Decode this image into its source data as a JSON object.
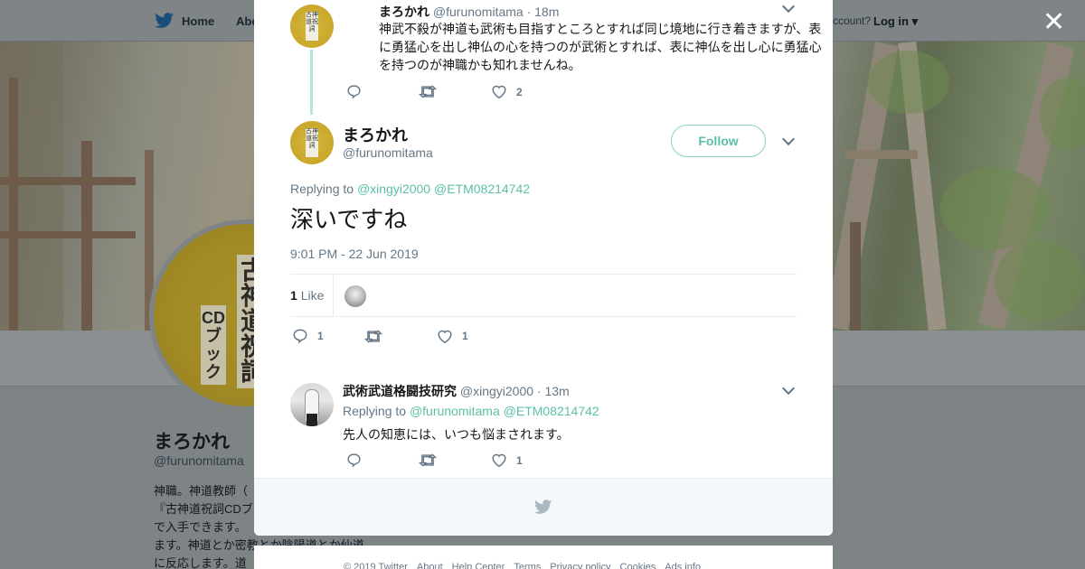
{
  "topbar": {
    "home_label": "Home",
    "about_label": "Abo",
    "account_prompt": "ccount?",
    "login_label": "Log in"
  },
  "background_profile": {
    "name": "まろかれ",
    "handle": "@furunomitama",
    "bio_lines": [
      "神職。神道教師（",
      "『古神道祝詞CDブ",
      "で入手できます。",
      "ます。神道とか密教とか陰陽道とか仙道",
      "に反応します。道"
    ],
    "avatar_text_main": "古神道祝詞",
    "avatar_text_sub": "CDブック"
  },
  "close_label": "✕",
  "ancestor_tweet": {
    "name": "まろかれ",
    "handle": "@furunomitama",
    "time": "· 18m",
    "avatar_label": "古神道祝詞",
    "text": "神武不殺が神道も武術も目指すところとすれば同じ境地に行き着きますが、表に勇猛心を出し神仏の心を持つのが武術とすれば、表に神仏を出し心に勇猛心を持つのが神職かも知れませんね。",
    "reply_count": "",
    "retweet_count": "",
    "like_count": "2"
  },
  "main_tweet": {
    "name": "まろかれ",
    "handle": "@furunomitama",
    "avatar_label": "古神道祝詞",
    "follow_label": "Follow",
    "replying_prefix": "Replying to",
    "replying_to": [
      "@xingyi2000",
      "@ETM08214742"
    ],
    "text": "深いですね",
    "timestamp": "9:01 PM - 22 Jun 2019",
    "likes_count": "1",
    "likes_label": "Like",
    "reply_count": "1",
    "retweet_count": "",
    "like_count": "1"
  },
  "reply_tweet": {
    "name": "武術武道格闘技研究",
    "handle": "@xingyi2000",
    "time": "· 13m",
    "replying_prefix": "Replying to",
    "replying_to": [
      "@furunomitama",
      "@ETM08214742"
    ],
    "text": "先人の知恵には、いつも悩まされます。",
    "reply_count": "",
    "retweet_count": "",
    "like_count": "1"
  },
  "footer": {
    "links": [
      "© 2019 Twitter",
      "About",
      "Help Center",
      "Terms",
      "Privacy policy",
      "Cookies",
      "Ads info"
    ]
  },
  "colors": {
    "accent": "#5bbfa8",
    "muted": "#657786",
    "twitter_blue": "#1da1f2"
  }
}
